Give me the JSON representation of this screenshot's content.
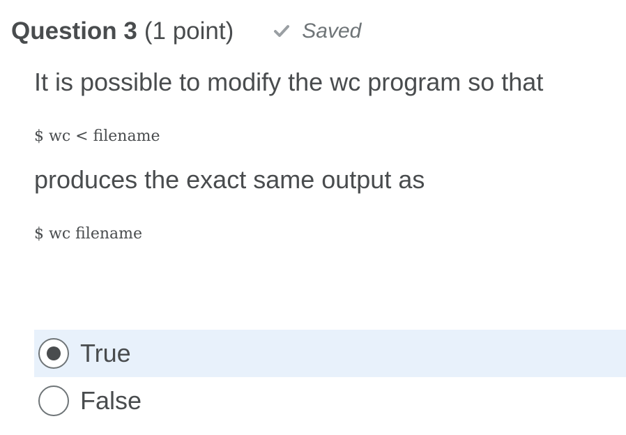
{
  "question": {
    "title": "Question 3",
    "points": "(1 point)",
    "status": {
      "icon": "check-icon",
      "label": "Saved"
    }
  },
  "prompt": {
    "line1": "It is possible to modify the wc program so that",
    "code1": "$ wc < filename",
    "line2": "produces the exact same output as",
    "code2": "$ wc filename"
  },
  "options": [
    {
      "label": "True",
      "selected": true
    },
    {
      "label": "False",
      "selected": false
    }
  ],
  "colors": {
    "text": "#494c4e",
    "muted": "#6e7477",
    "selected_background": "#e8f1fb"
  }
}
